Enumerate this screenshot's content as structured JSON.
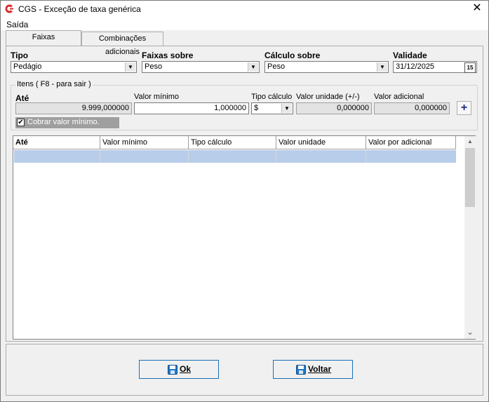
{
  "window": {
    "title": "CGS - Exceção de taxa genérica",
    "close": "✕"
  },
  "menu": {
    "saida": "Saída"
  },
  "tabs": [
    {
      "label": "Faixas"
    },
    {
      "label": "Combinações adicionais"
    }
  ],
  "filters": {
    "tipo_label": "Tipo",
    "tipo_value": "Pedágio",
    "faixas_label": "Faixas sobre",
    "faixas_value": "Peso",
    "calculo_label": "Cálculo sobre",
    "calculo_value": "Peso",
    "validade_label": "Validade",
    "validade_value": "31/12/2025",
    "calendar_icon": "15"
  },
  "itens": {
    "group_title": "Itens ( F8 - para sair )",
    "ate_label": "Até",
    "ate_value": "9.999,000000",
    "valor_minimo_label": "Valor mínimo",
    "valor_minimo_value": "1,000000",
    "tipo_calculo_label": "Tipo cálculo",
    "tipo_calculo_value": "$",
    "valor_unidade_label": "Valor unidade (+/-)",
    "valor_unidade_value": "0,000000",
    "valor_adicional_label": "Valor adicional",
    "valor_adicional_value": "0,000000",
    "add_symbol": "+",
    "cobrar_label": "Cobrar valor mínimo.",
    "cobrar_checked": true,
    "check_mark": "✔"
  },
  "grid": {
    "columns": [
      "Até",
      "Valor mínimo",
      "Tipo cálculo",
      "Valor unidade",
      "Valor por adicional"
    ],
    "scroll_up": "▲",
    "scroll_down": "⌄"
  },
  "footer": {
    "ok_label": "Ok",
    "voltar_label": "Voltar"
  },
  "colors": {
    "accent": "#1b6fb8",
    "selected_row": "#b8cdea",
    "logo": "#d62b2b"
  }
}
